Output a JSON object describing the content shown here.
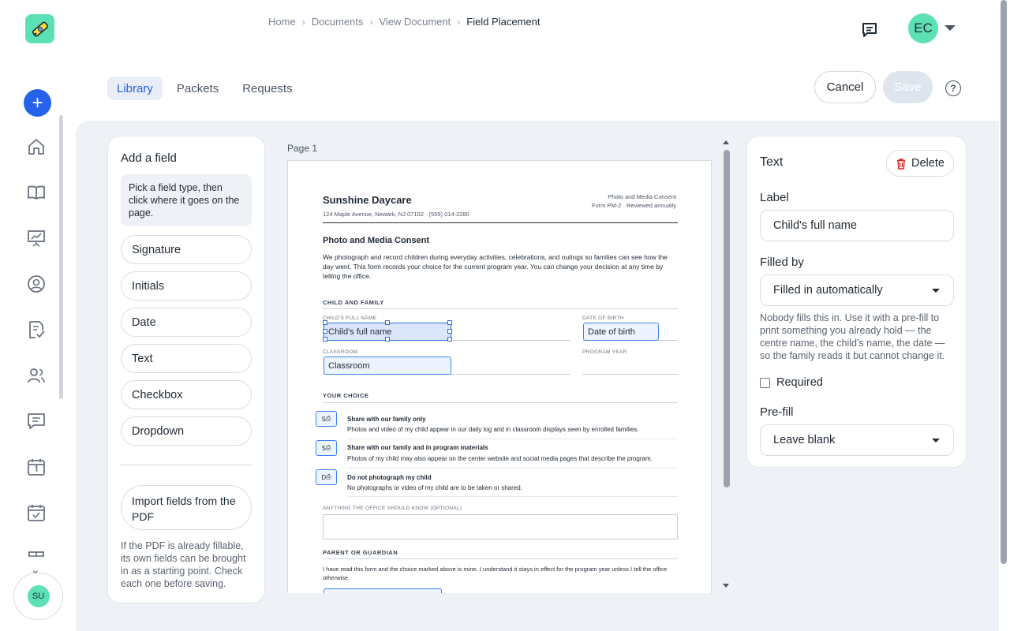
{
  "breadcrumb": [
    "Home",
    "Documents",
    "View Document",
    "Field Placement"
  ],
  "user": {
    "initials": "EC",
    "rail_initials": "SU"
  },
  "tabs": [
    "Library",
    "Packets",
    "Requests"
  ],
  "actions": {
    "cancel": "Cancel",
    "save": "Save",
    "help": "?"
  },
  "palette": {
    "title": "Add a field",
    "hint": "Pick a field type, then click where it goes on the page.",
    "types": [
      "Signature",
      "Initials",
      "Date",
      "Text",
      "Checkbox",
      "Dropdown"
    ],
    "import_label": "Import fields from the PDF",
    "import_note": "If the PDF is already fillable, its own fields can be brought in as a starting point. Check each one before saving."
  },
  "page_label": "Page 1",
  "document": {
    "org": "Sunshine Daycare",
    "address": "124 Maple Avenue, Newark, NJ 07102  ·  (555) 014-2280",
    "form_title": "Photo and Media Consent",
    "form_code": "Form PM-2  ·  Reviewed annually",
    "heading": "Photo and Media Consent",
    "intro": "We photograph and record children during everyday activities, celebrations, and outings so families can see how the day went. This form records your choice for the current program year. You can change your decision at any time by telling the office.",
    "section_child": "CHILD AND FAMILY",
    "label_childname": "CHILD'S FULL NAME",
    "label_dob": "DATE OF BIRTH",
    "label_classroom": "CLASSROOM",
    "label_year": "PROGRAM YEAR",
    "section_choice": "YOUR CHOICE",
    "options": [
      {
        "box": "S",
        "title": "Share with our family only",
        "desc": "Photos and video of my child appear in our daily log and in classroom displays seen by enrolled families."
      },
      {
        "box": "S",
        "title": "Share with our family and in program materials",
        "desc": "Photos of my child may also appear on the center website and social media pages that describe the program."
      },
      {
        "box": "D",
        "title": "Do not photograph my child",
        "desc": "No photographs or video of my child are to be taken or shared."
      }
    ],
    "label_notes": "ANYTHING THE OFFICE SHOULD KNOW (OPTIONAL)",
    "section_parent": "PARENT OR GUARDIAN",
    "consent": "I have read this form and the choice marked above is mine. I understand it stays in effect for the program year unless I tell the office otherwise.",
    "placed_fields": {
      "childname": "Child's full name",
      "dob": "Date of birth",
      "classroom": "Classroom"
    }
  },
  "properties": {
    "title": "Text",
    "delete": "Delete",
    "label_heading": "Label",
    "label_value": "Child's full name",
    "filled_by_heading": "Filled by",
    "filled_by_value": "Filled in automatically",
    "help": "Nobody fills this in. Use it with a pre-fill to print something you already hold — the centre name, the child's name, the date — so the family reads it but cannot change it.",
    "required": "Required",
    "required_checked": false,
    "prefill_heading": "Pre-fill",
    "prefill_value": "Leave blank"
  },
  "colors": {
    "accent": "#2563eb",
    "brand": "#5ee0b5",
    "field_border": "#3b82f6"
  }
}
